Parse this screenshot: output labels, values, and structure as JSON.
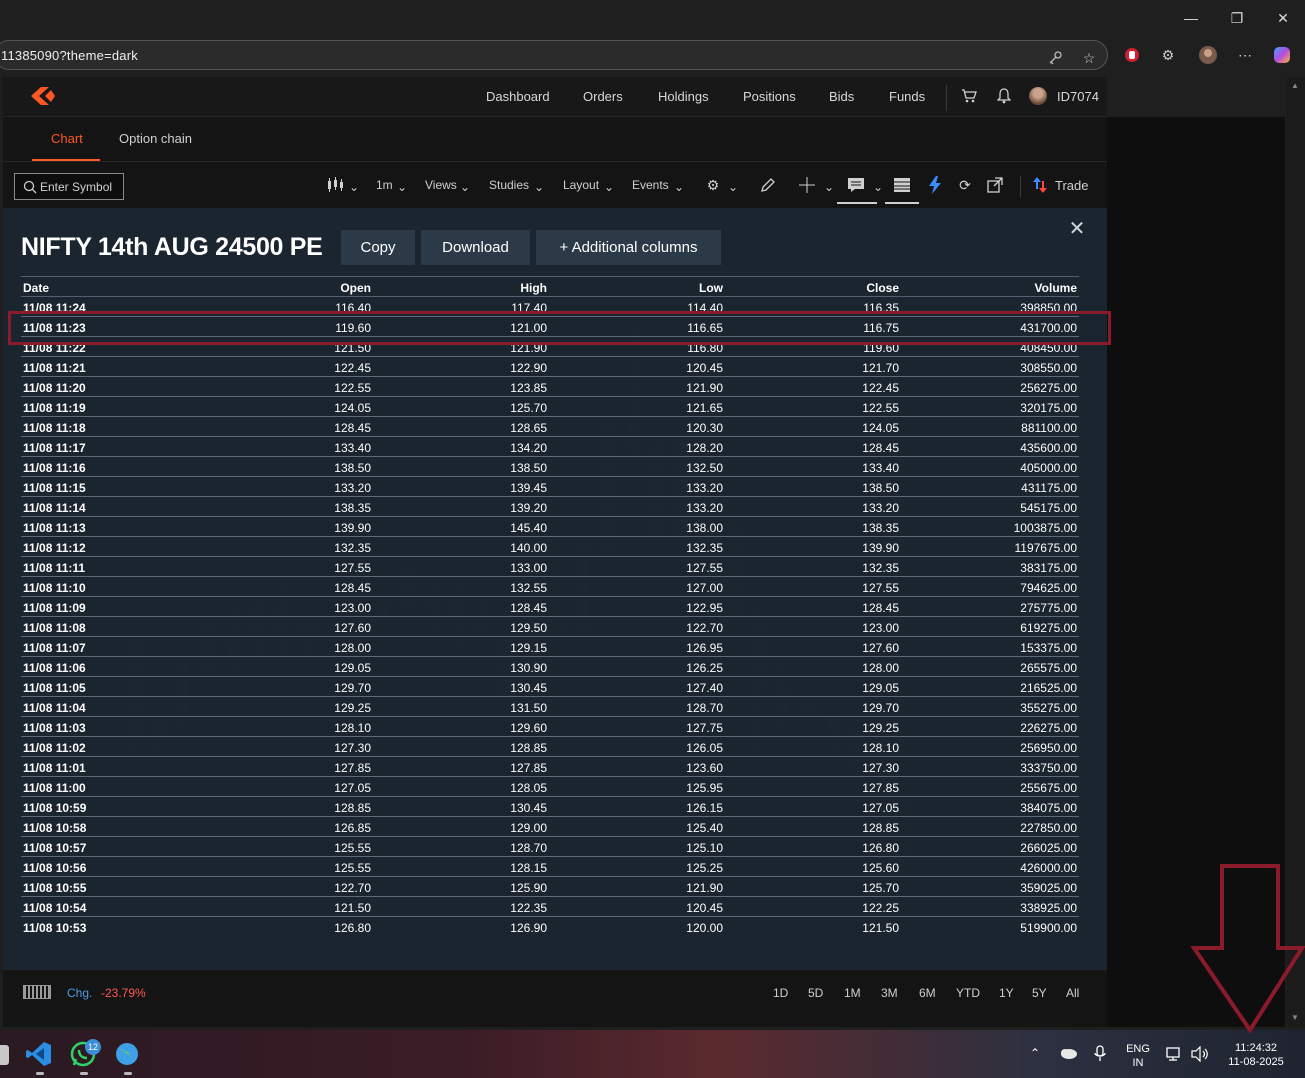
{
  "browser": {
    "url_fragment": "11385090?theme=dark"
  },
  "nav": {
    "items": [
      "Dashboard",
      "Orders",
      "Holdings",
      "Positions",
      "Bids",
      "Funds"
    ],
    "user_id": "ID7074"
  },
  "tabs": {
    "chart": "Chart",
    "option_chain": "Option chain"
  },
  "toolbar": {
    "symbol_placeholder": "Enter Symbol",
    "interval": "1m",
    "views": "Views",
    "studies": "Studies",
    "layout": "Layout",
    "events": "Events",
    "trade": "Trade"
  },
  "panel": {
    "title": "NIFTY 14th AUG 24500 PE",
    "copy_label": "Copy",
    "download_label": "Download",
    "additional_label": "+ Additional columns",
    "close_symbol": "✕"
  },
  "table": {
    "headers": [
      "Date",
      "Open",
      "High",
      "Low",
      "Close",
      "Volume"
    ],
    "highlighted_row": "11/08 11:23",
    "rows": [
      [
        "11/08 11:24",
        "116.40",
        "117.40",
        "114.40",
        "116.35",
        "398850.00"
      ],
      [
        "11/08 11:23",
        "119.60",
        "121.00",
        "116.65",
        "116.75",
        "431700.00"
      ],
      [
        "11/08 11:22",
        "121.50",
        "121.90",
        "116.80",
        "119.60",
        "408450.00"
      ],
      [
        "11/08 11:21",
        "122.45",
        "122.90",
        "120.45",
        "121.70",
        "308550.00"
      ],
      [
        "11/08 11:20",
        "122.55",
        "123.85",
        "121.90",
        "122.45",
        "256275.00"
      ],
      [
        "11/08 11:19",
        "124.05",
        "125.70",
        "121.65",
        "122.55",
        "320175.00"
      ],
      [
        "11/08 11:18",
        "128.45",
        "128.65",
        "120.30",
        "124.05",
        "881100.00"
      ],
      [
        "11/08 11:17",
        "133.40",
        "134.20",
        "128.20",
        "128.45",
        "435600.00"
      ],
      [
        "11/08 11:16",
        "138.50",
        "138.50",
        "132.50",
        "133.40",
        "405000.00"
      ],
      [
        "11/08 11:15",
        "133.20",
        "139.45",
        "133.20",
        "138.50",
        "431175.00"
      ],
      [
        "11/08 11:14",
        "138.35",
        "139.20",
        "133.20",
        "133.20",
        "545175.00"
      ],
      [
        "11/08 11:13",
        "139.90",
        "145.40",
        "138.00",
        "138.35",
        "1003875.00"
      ],
      [
        "11/08 11:12",
        "132.35",
        "140.00",
        "132.35",
        "139.90",
        "1197675.00"
      ],
      [
        "11/08 11:11",
        "127.55",
        "133.00",
        "127.55",
        "132.35",
        "383175.00"
      ],
      [
        "11/08 11:10",
        "128.45",
        "132.55",
        "127.00",
        "127.55",
        "794625.00"
      ],
      [
        "11/08 11:09",
        "123.00",
        "128.45",
        "122.95",
        "128.45",
        "275775.00"
      ],
      [
        "11/08 11:08",
        "127.60",
        "129.50",
        "122.70",
        "123.00",
        "619275.00"
      ],
      [
        "11/08 11:07",
        "128.00",
        "129.15",
        "126.95",
        "127.60",
        "153375.00"
      ],
      [
        "11/08 11:06",
        "129.05",
        "130.90",
        "126.25",
        "128.00",
        "265575.00"
      ],
      [
        "11/08 11:05",
        "129.70",
        "130.45",
        "127.40",
        "129.05",
        "216525.00"
      ],
      [
        "11/08 11:04",
        "129.25",
        "131.50",
        "128.70",
        "129.70",
        "355275.00"
      ],
      [
        "11/08 11:03",
        "128.10",
        "129.60",
        "127.75",
        "129.25",
        "226275.00"
      ],
      [
        "11/08 11:02",
        "127.30",
        "128.85",
        "126.05",
        "128.10",
        "256950.00"
      ],
      [
        "11/08 11:01",
        "127.85",
        "127.85",
        "123.60",
        "127.30",
        "333750.00"
      ],
      [
        "11/08 11:00",
        "127.05",
        "128.05",
        "125.95",
        "127.85",
        "255675.00"
      ],
      [
        "11/08 10:59",
        "128.85",
        "130.45",
        "126.15",
        "127.05",
        "384075.00"
      ],
      [
        "11/08 10:58",
        "126.85",
        "129.00",
        "125.40",
        "128.85",
        "227850.00"
      ],
      [
        "11/08 10:57",
        "125.55",
        "128.70",
        "125.10",
        "126.80",
        "266025.00"
      ],
      [
        "11/08 10:56",
        "125.55",
        "128.15",
        "125.25",
        "125.60",
        "426000.00"
      ],
      [
        "11/08 10:55",
        "122.70",
        "125.90",
        "121.90",
        "125.70",
        "359025.00"
      ],
      [
        "11/08 10:54",
        "121.50",
        "122.35",
        "120.45",
        "122.25",
        "338925.00"
      ],
      [
        "11/08 10:53",
        "126.80",
        "126.90",
        "120.00",
        "121.50",
        "519900.00"
      ]
    ]
  },
  "bottom": {
    "chg_label": "Chg.",
    "chg_value": "-23.79%",
    "ranges": [
      "1D",
      "5D",
      "1M",
      "3M",
      "6M",
      "YTD",
      "1Y",
      "5Y",
      "All"
    ]
  },
  "taskbar": {
    "whatsapp_badge": "12",
    "lang_line1": "ENG",
    "lang_line2": "IN",
    "time": "11:24:32",
    "date": "11-08-2025"
  },
  "colors": {
    "accent": "#ff5722",
    "highlight_box": "#8b1a2b",
    "change_negative": "#ff5a5a",
    "chg_label": "#4a9de8"
  }
}
